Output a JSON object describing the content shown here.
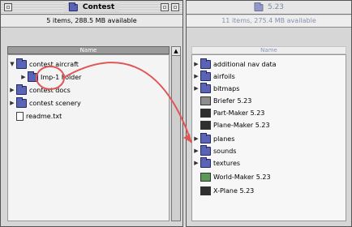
{
  "left_window": {
    "title": "Contest",
    "info": "5 items, 288.5 MB available",
    "column_header": "Name",
    "items": [
      {
        "label": "contest aircraft",
        "type": "folder",
        "expanded": true
      },
      {
        "label": "Imp-1 Folder",
        "type": "folder",
        "expanded": false
      },
      {
        "label": "contest docs",
        "type": "folder",
        "expanded": false
      },
      {
        "label": "contest scenery",
        "type": "folder",
        "expanded": false
      },
      {
        "label": "readme.txt",
        "type": "document"
      }
    ]
  },
  "right_window": {
    "title": "5.23",
    "info": "11 items, 275.4 MB available",
    "column_header": "Name",
    "items": [
      {
        "label": "additional nav data",
        "type": "folder"
      },
      {
        "label": "airfoils",
        "type": "folder"
      },
      {
        "label": "bitmaps",
        "type": "folder"
      },
      {
        "label": "Briefer 5.23",
        "type": "application"
      },
      {
        "label": "Part-Maker 5.23",
        "type": "application"
      },
      {
        "label": "Plane-Maker 5.23",
        "type": "application"
      },
      {
        "label": "planes",
        "type": "folder"
      },
      {
        "label": "sounds",
        "type": "folder"
      },
      {
        "label": "textures",
        "type": "folder"
      },
      {
        "label": "World-Maker 5.23",
        "type": "application"
      },
      {
        "label": "X-Plane 5.23",
        "type": "application"
      }
    ]
  },
  "annotation": {
    "color": "#e05555"
  },
  "icons": {
    "folder": "folder-icon",
    "document": "document-icon",
    "application": "application-icon",
    "disclosure": "disclosure-triangle-icon"
  }
}
